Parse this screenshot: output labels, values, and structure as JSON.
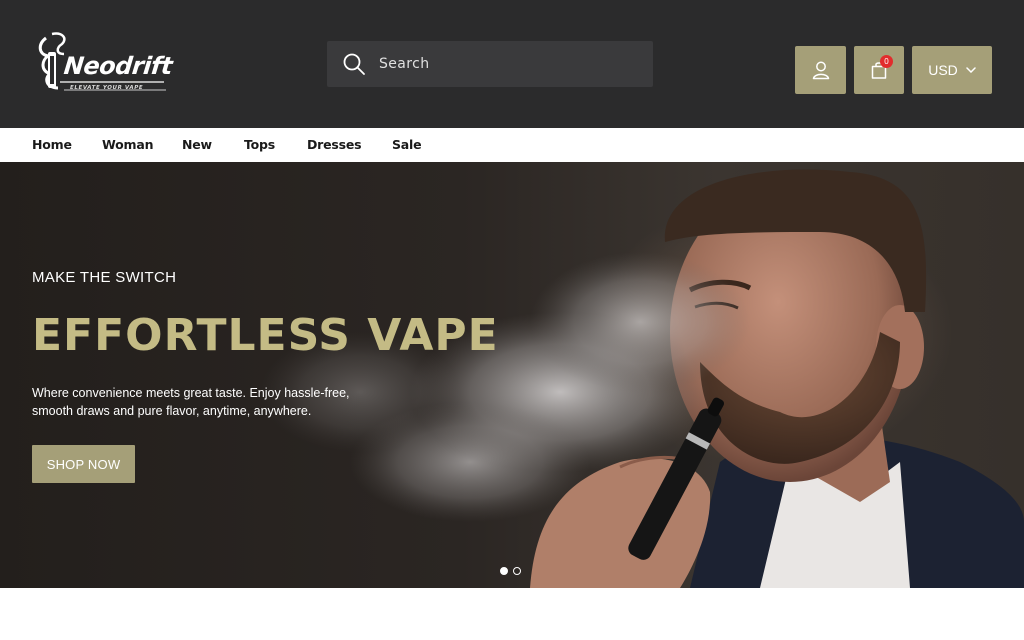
{
  "brand": {
    "logo_text": "Neodrift",
    "tagline": "ELEVATE YOUR VAPE"
  },
  "search": {
    "placeholder": "Search"
  },
  "header_actions": {
    "cart_count": "0",
    "currency": "USD"
  },
  "nav": {
    "items": [
      "Home",
      "Woman",
      "New",
      "Tops",
      "Dresses",
      "Sale"
    ]
  },
  "hero": {
    "subtitle": "MAKE THE SWITCH",
    "title": "EFFORTLESS VAPE",
    "description_line1": "Where convenience meets great taste. Enjoy hassle-free,",
    "description_line2": "smooth draws and pure flavor, anytime, anywhere.",
    "cta_label": "SHOP NOW",
    "slide_current": 1,
    "slide_total": 2
  },
  "colors": {
    "header_bg": "#2b2b2c",
    "accent": "#a59f78",
    "hero_title": "#c4bb85",
    "badge": "#e22c2c"
  },
  "icons": {
    "search": "search-icon",
    "account": "user-icon",
    "cart": "shopping-bag-icon",
    "dropdown": "chevron-down-icon"
  }
}
